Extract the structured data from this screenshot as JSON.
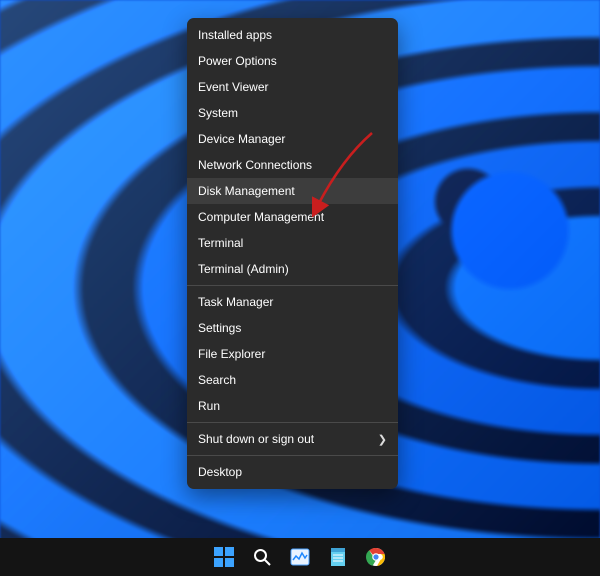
{
  "context_menu": {
    "groups": [
      [
        "Installed apps",
        "Power Options",
        "Event Viewer",
        "System",
        "Device Manager",
        "Network Connections",
        "Disk Management",
        "Computer Management",
        "Terminal",
        "Terminal (Admin)"
      ],
      [
        "Task Manager",
        "Settings",
        "File Explorer",
        "Search",
        "Run"
      ],
      [
        "Shut down or sign out"
      ],
      [
        "Desktop"
      ]
    ],
    "highlighted": "Disk Management",
    "submenu": "Shut down or sign out"
  },
  "annotation": {
    "type": "arrow",
    "color": "#c81e1e",
    "points_to": "Disk Management"
  },
  "taskbar": {
    "items": [
      {
        "name": "start",
        "label": "Start"
      },
      {
        "name": "search",
        "label": "Search"
      },
      {
        "name": "taskmanager",
        "label": "Task Manager"
      },
      {
        "name": "notepad",
        "label": "Notepad"
      },
      {
        "name": "chrome",
        "label": "Google Chrome"
      }
    ]
  },
  "colors": {
    "menu_bg": "#2b2b2b",
    "menu_highlight": "#3d3d3d",
    "taskbar_bg": "#141414"
  }
}
